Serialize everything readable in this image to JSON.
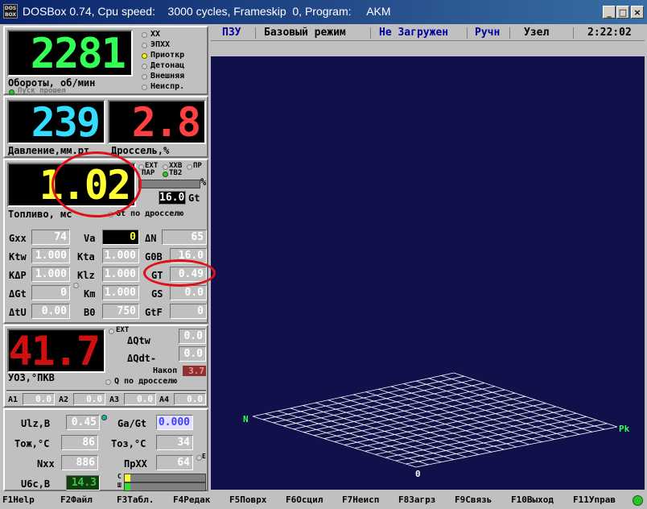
{
  "window": {
    "icon_text": "DOS BOX",
    "title": "DOSBox 0.74, Cpu speed:    3000 cycles, Frameskip  0, Program:     AKM",
    "buttons": {
      "minimize": "_",
      "maximize": "□",
      "close": "×"
    }
  },
  "rpm": {
    "value": "2281",
    "label": "Обороты, об/мин",
    "start_status": "Пуск прошел",
    "modes": [
      "XX",
      "ЭПХХ",
      "Приоткр",
      "Детонац",
      "Внешняя",
      "Неиспр."
    ],
    "active_mode": "Приоткр"
  },
  "pressure": {
    "value": "239",
    "label": "Давление,мм.рт"
  },
  "throttle": {
    "value": "2.8",
    "label": "Дроссель,%"
  },
  "fuel": {
    "value": "1.02",
    "label": "Топливо, мс",
    "opt_ext": "EXT",
    "opt_xxb": "XXB",
    "opt_pr": "ПР",
    "opt_par": "ПАР",
    "opt_tb2": "TB2",
    "percent_sign": "%",
    "gt_value": "16.0",
    "gt_label": "Gt",
    "throttle_opt": "Gt по дросселю"
  },
  "params": [
    {
      "label": "Gxx",
      "value": "74"
    },
    {
      "label": "Va",
      "value": "0"
    },
    {
      "label": "ΔN",
      "value": "65"
    },
    {
      "label": "Ktw",
      "value": "1.000"
    },
    {
      "label": "Kta",
      "value": "1.000"
    },
    {
      "label": "G0B",
      "value": "16.0"
    },
    {
      "label": "KΔP",
      "value": "1.000"
    },
    {
      "label": "Klz",
      "value": "1.000"
    },
    {
      "label": "GT",
      "value": "0.49"
    },
    {
      "label": "ΔGt",
      "value": "0"
    },
    {
      "label": "Km",
      "value": "1.000"
    },
    {
      "label": "GS",
      "value": "0.0"
    },
    {
      "label": "ΔtU",
      "value": "0.00"
    },
    {
      "label": "B0",
      "value": "750"
    },
    {
      "label": "GtF",
      "value": "0"
    }
  ],
  "ignition": {
    "value": "41.7",
    "label": "УОЗ,°ПКВ",
    "opt_ext": "EXT",
    "dqtw_label": "ΔQtw",
    "dqtw_value": "0.0",
    "dqdt_label": "ΔQdt-",
    "dqdt_value": "0.0",
    "nakop_label": "Накоп",
    "nakop_value": "3.7",
    "throttle_opt": "Q по дросселю"
  },
  "aux": [
    {
      "label": "A1",
      "value": "0.0"
    },
    {
      "label": "A2",
      "value": "0.0"
    },
    {
      "label": "A3",
      "value": "0.0"
    },
    {
      "label": "A4",
      "value": "0.0"
    }
  ],
  "status": [
    {
      "label": "Ulz,B",
      "value": "0.45"
    },
    {
      "label": "Ga/Gt",
      "value": "0.000"
    },
    {
      "label": "Тож,°C",
      "value": "86"
    },
    {
      "label": "Тоз,°C",
      "value": "34"
    },
    {
      "label": "Nxx",
      "value": "886"
    },
    {
      "label": "ПрXX",
      "value": "64"
    },
    {
      "label": "U6c,B",
      "value": "14.3"
    }
  ],
  "status_e": "E",
  "status_c": "C",
  "status_sh": "Ш",
  "menu": {
    "items": [
      "ПЗУ",
      "Базовый режим",
      "Не Загружен",
      "Ручн",
      "Узел"
    ],
    "time": "2:22:02"
  },
  "graph": {
    "label_n": "N",
    "label_pk": "Pk",
    "label_zero": "0"
  },
  "fkeys": [
    {
      "key": "F1",
      "label": "Help"
    },
    {
      "key": "F2",
      "label": "Файл"
    },
    {
      "key": "F3",
      "label": "Табл."
    },
    {
      "key": "F4",
      "label": "Редак"
    },
    {
      "key": "F5",
      "label": "Поврх"
    },
    {
      "key": "F6",
      "label": "Осцил"
    },
    {
      "key": "F7",
      "label": "Неисп"
    },
    {
      "key": "F8",
      "label": "Загрз"
    },
    {
      "key": "F9",
      "label": "Связь"
    },
    {
      "key": "F10",
      "label": "Выход"
    },
    {
      "key": "F11",
      "label": "Управ"
    }
  ],
  "colors": {
    "rpm": "#33ff55",
    "pressure": "#33ddff",
    "throttle": "#ff4040",
    "fuel": "#ffff33",
    "ignition": "#d01010",
    "graph_bg": "#10104a",
    "mesh": "#ffffff",
    "highlight": "#e0101a"
  }
}
